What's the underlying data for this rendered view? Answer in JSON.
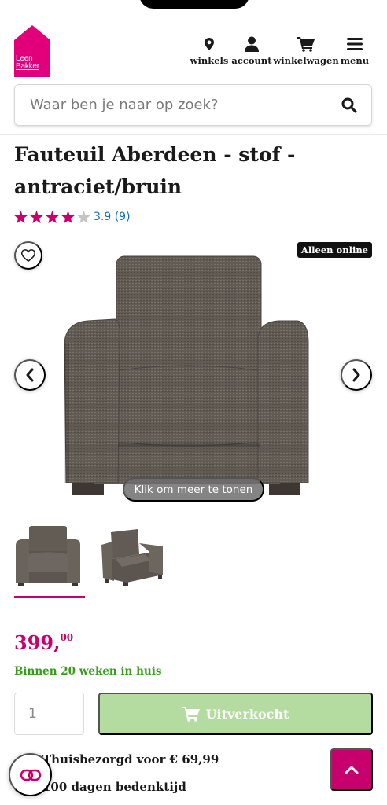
{
  "brand": {
    "logo_line1": "Leen",
    "logo_line2": "Bakker",
    "color": "#e2007a"
  },
  "nav": {
    "stores_label": "winkels",
    "account_label": "account",
    "cart_label": "winkelwagen",
    "menu_label": "menu"
  },
  "search": {
    "placeholder": "Waar ben je naar op zoek?"
  },
  "product": {
    "title": "Fauteuil Aberdeen - stof - antraciet/bruin",
    "rating": 3.9,
    "rating_text": "3.9 (9)",
    "stars_filled": 4,
    "stars_total": 5
  },
  "gallery": {
    "badge": "Alleen online",
    "more_button": "Klik om meer te tonen",
    "thumbnail_count": 2,
    "active_thumbnail": 1
  },
  "pricing": {
    "euros": "399,",
    "cents": "00",
    "delivery": "Binnen 20 weken in huis",
    "accent_color": "#c8006e"
  },
  "purchase": {
    "quantity": "1",
    "button_label": "Uitverkocht",
    "button_color": "#b4dca0"
  },
  "usps": [
    "Thuisbezorgd voor € 69,99",
    "100 dagen bedenktijd"
  ]
}
